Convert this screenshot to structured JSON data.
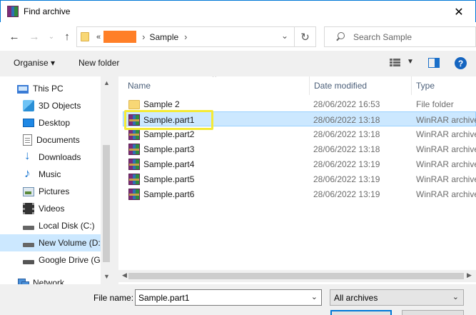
{
  "window": {
    "title": "Find archive",
    "close_glyph": "✕"
  },
  "nav": {
    "back_glyph": "←",
    "forward_glyph": "→",
    "recent_glyph": "⌄",
    "up_glyph": "↑",
    "address": {
      "overflow": "«",
      "crumbs": [
        "Sample"
      ],
      "chevron": "›",
      "dropdown_glyph": "⌄",
      "refresh_glyph": "↻"
    },
    "search_placeholder": "Search Sample"
  },
  "toolbar": {
    "organise": "Organise ▾",
    "new_folder": "New folder",
    "view_dd": "▼",
    "help": "?"
  },
  "navpane": {
    "items": [
      {
        "label": "This PC",
        "icon": "pc-icon",
        "selected": false
      },
      {
        "label": "3D Objects",
        "icon": "3d-objects-icon",
        "selected": false
      },
      {
        "label": "Desktop",
        "icon": "desktop-icon",
        "selected": false
      },
      {
        "label": "Documents",
        "icon": "documents-icon",
        "selected": false
      },
      {
        "label": "Downloads",
        "icon": "downloads-icon",
        "selected": false
      },
      {
        "label": "Music",
        "icon": "music-icon",
        "selected": false
      },
      {
        "label": "Pictures",
        "icon": "pictures-icon",
        "selected": false
      },
      {
        "label": "Videos",
        "icon": "videos-icon",
        "selected": false
      },
      {
        "label": "Local Disk (C:)",
        "icon": "disk-icon",
        "selected": false
      },
      {
        "label": "New Volume (D:",
        "icon": "disk-icon",
        "selected": true
      },
      {
        "label": "Google Drive (G:",
        "icon": "drive-icon",
        "selected": false
      },
      {
        "label": "Network",
        "icon": "network-icon",
        "selected": false
      }
    ],
    "scroll_up": "▲",
    "scroll_down": "▼"
  },
  "filelist": {
    "columns": [
      "Name",
      "Date modified",
      "Type"
    ],
    "sort_glyph": "^",
    "rows": [
      {
        "name": "Sample 2",
        "date": "28/06/2022 16:53",
        "type": "File folder",
        "kind": "folder"
      },
      {
        "name": "Sample.part1",
        "date": "28/06/2022 13:18",
        "type": "WinRAR archive",
        "kind": "rar"
      },
      {
        "name": "Sample.part2",
        "date": "28/06/2022 13:18",
        "type": "WinRAR archive",
        "kind": "rar"
      },
      {
        "name": "Sample.part3",
        "date": "28/06/2022 13:18",
        "type": "WinRAR archive",
        "kind": "rar"
      },
      {
        "name": "Sample.part4",
        "date": "28/06/2022 13:19",
        "type": "WinRAR archive",
        "kind": "rar"
      },
      {
        "name": "Sample.part5",
        "date": "28/06/2022 13:19",
        "type": "WinRAR archive",
        "kind": "rar"
      },
      {
        "name": "Sample.part6",
        "date": "28/06/2022 13:19",
        "type": "WinRAR archive",
        "kind": "rar"
      }
    ],
    "selected_row": "Sample.part1",
    "scroll_left": "◀",
    "scroll_right": "▶"
  },
  "footer": {
    "filename_label": "File name:",
    "filename_value": "Sample.part1",
    "filename_dd": "⌄",
    "filter_value": "All archives",
    "filter_dd": "⌄"
  },
  "colors": {
    "accent": "#0078d7",
    "selection": "#cce8ff",
    "highlight": "#f4ea37",
    "redaction": "#ff7f27"
  }
}
